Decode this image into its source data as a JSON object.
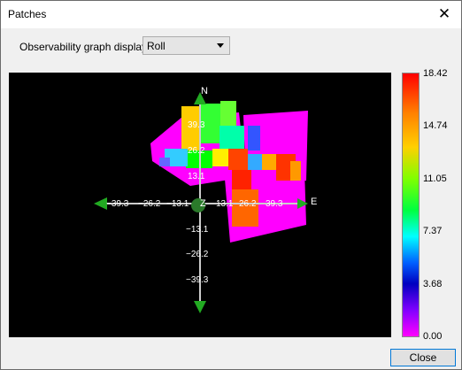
{
  "window": {
    "title": "Patches",
    "close_glyph": "✕"
  },
  "controls": {
    "display_label": "Observability graph display:",
    "display_value": "Roll"
  },
  "viewport": {
    "north": "N",
    "east": "E",
    "origin": "Z",
    "x_ticks": [
      "−39.3",
      "−26.2",
      "−13.1",
      "13.1",
      "26.2",
      "39.3"
    ],
    "y_ticks_up": [
      "13.1",
      "26.2",
      "39.3"
    ],
    "y_ticks_down": [
      "−13.1",
      "−26.2",
      "−39.3"
    ]
  },
  "colorbar": {
    "ticks": [
      "18.42",
      "14.74",
      "11.05",
      "7.37",
      "3.68",
      "0.00"
    ]
  },
  "footer": {
    "close_label": "Close"
  }
}
